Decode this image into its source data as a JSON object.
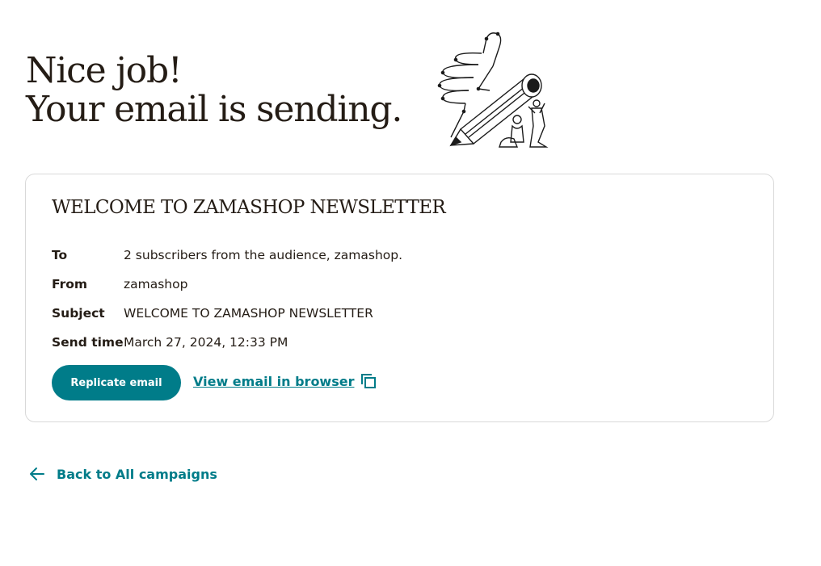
{
  "header": {
    "line1": "Nice job!",
    "line2": "Your email is sending."
  },
  "illustration": {
    "icon": "thumbs-up-pencil-illustration"
  },
  "campaign": {
    "title": "WELCOME TO ZAMASHOP NEWSLETTER",
    "details": [
      {
        "label": "To",
        "value": "2 subscribers from the audience, zamashop."
      },
      {
        "label": "From",
        "value": "zamashop"
      },
      {
        "label": "Subject",
        "value": "WELCOME TO ZAMASHOP NEWSLETTER"
      },
      {
        "label": "Send time",
        "value": "March 27, 2024, 12:33 PM"
      }
    ],
    "replicate_label": "Replicate email",
    "view_label": "View email in browser",
    "view_icon": "copy-icon"
  },
  "footer": {
    "back_label": "Back to All campaigns",
    "back_icon": "arrow-left-icon"
  },
  "colors": {
    "accent": "#007c89",
    "text": "#241c15",
    "border": "#d9d9d9"
  }
}
